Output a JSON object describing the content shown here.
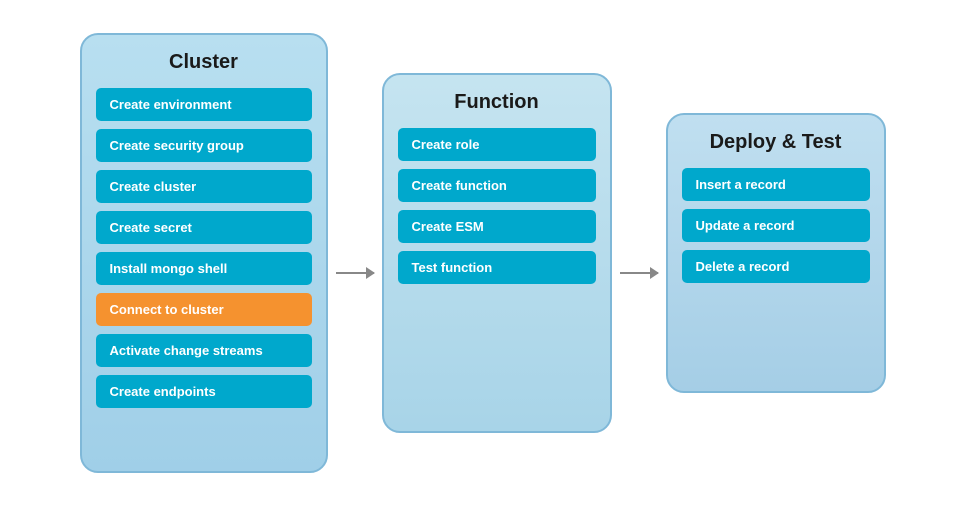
{
  "cluster": {
    "title": "Cluster",
    "items": [
      {
        "label": "Create environment",
        "active": false
      },
      {
        "label": "Create security group",
        "active": false
      },
      {
        "label": "Create cluster",
        "active": false
      },
      {
        "label": "Create secret",
        "active": false
      },
      {
        "label": "Install mongo shell",
        "active": false
      },
      {
        "label": "Connect to cluster",
        "active": true
      },
      {
        "label": "Activate change streams",
        "active": false
      },
      {
        "label": "Create endpoints",
        "active": false
      }
    ]
  },
  "function": {
    "title": "Function",
    "items": [
      {
        "label": "Create role",
        "active": false
      },
      {
        "label": "Create function",
        "active": false
      },
      {
        "label": "Create ESM",
        "active": false
      },
      {
        "label": "Test function",
        "active": false
      }
    ]
  },
  "deploy": {
    "title": "Deploy & Test",
    "items": [
      {
        "label": "Insert a record",
        "active": false
      },
      {
        "label": "Update a record",
        "active": false
      },
      {
        "label": "Delete a record",
        "active": false
      }
    ]
  },
  "arrows": [
    {
      "id": "arrow-1"
    },
    {
      "id": "arrow-2"
    }
  ]
}
